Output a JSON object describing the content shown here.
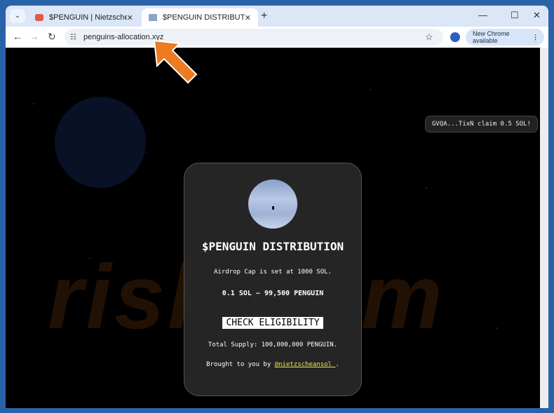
{
  "browser": {
    "tabs": [
      {
        "title": "$PENGUIN | Nietzschean Pengu"
      },
      {
        "title": "$PENGUIN DISTRIBUTION"
      }
    ],
    "url": "penguins-allocation.xyz",
    "update_label": "New Chrome available"
  },
  "toast": {
    "text": "GVQA...TixN claim 0.5 SOL!"
  },
  "card": {
    "title": "$PENGUIN DISTRIBUTION",
    "cap": "Airdrop Cap is set at 1000 SOL.",
    "rate": "0.1 SOL ~ 99,500 PENGUIN",
    "button": "CHECK ELIGIBILITY",
    "supply": "Total Supply: 100,000,000 PENGUIN.",
    "credit_prefix": "Brought to you by ",
    "credit_link": "@nietzscheansol_",
    "credit_suffix": "."
  },
  "watermark": "risk.com"
}
